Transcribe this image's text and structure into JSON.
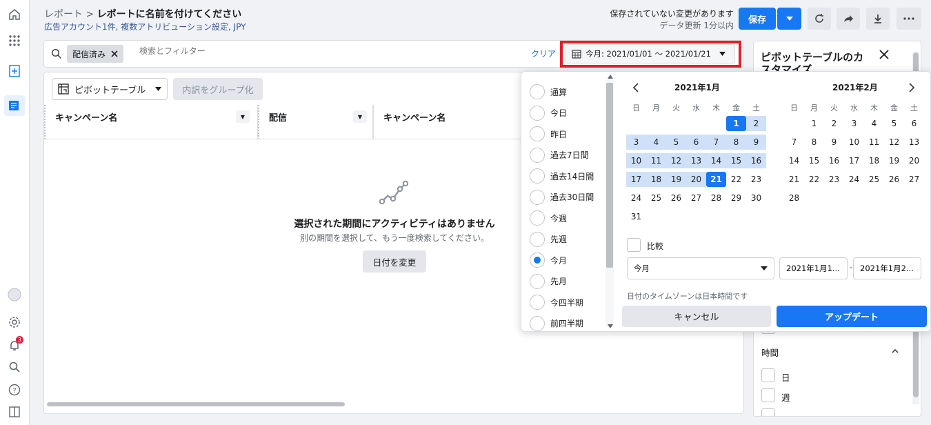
{
  "header": {
    "breadcrumb_parent": "レポート",
    "breadcrumb_sep": ">",
    "title": "レポートに名前を付けてください",
    "subtitle": "広告アカウント1件, 複数アトリビューション設定, JPY",
    "unsaved": "保存されていない変更があります",
    "updated": "データ更新 1分以内",
    "save_label": "保存"
  },
  "rail": {
    "notification_count": "3"
  },
  "search": {
    "chip": "配信済み",
    "placeholder": "検索とフィルター",
    "clear": "クリア",
    "date_range": "今月: 2021/01/01 ～ 2021/01/21"
  },
  "table": {
    "pivot_label": "ピボットテーブル",
    "group_label": "内訳をグループ化",
    "columns": [
      "キャンペーン名",
      "配信",
      "キャンペーン名"
    ],
    "empty_title": "選択された期間にアクティビティはありません",
    "empty_sub": "別の期間を選択して、もう一度検索してください。",
    "change_date": "日付を変更"
  },
  "right_panel": {
    "title": "ピボットテーブルのカスタマイズ",
    "section_time": "時間",
    "opt_day": "日",
    "opt_week": "週"
  },
  "date_picker": {
    "presets": [
      "通算",
      "今日",
      "昨日",
      "過去7日間",
      "過去14日間",
      "過去30日間",
      "今週",
      "先週",
      "今月",
      "先月",
      "今四半期",
      "前四半期"
    ],
    "selected_preset": "今月",
    "weekdays": [
      "日",
      "月",
      "火",
      "水",
      "木",
      "金",
      "土"
    ],
    "month1": "2021年1月",
    "month2": "2021年2月",
    "range_start": 1,
    "range_end": 21,
    "compare_label": "比較",
    "period_select": "今月",
    "start_field": "2021年1月1...",
    "end_field": "2021年1月2...",
    "range_dash": "-",
    "tz_note": "日付のタイムゾーンは日本時間です",
    "cancel": "キャンセル",
    "update": "アップデート"
  },
  "colors": {
    "accent": "#1877f2",
    "highlight": "#e41e28",
    "range": "#cfe0f9"
  }
}
